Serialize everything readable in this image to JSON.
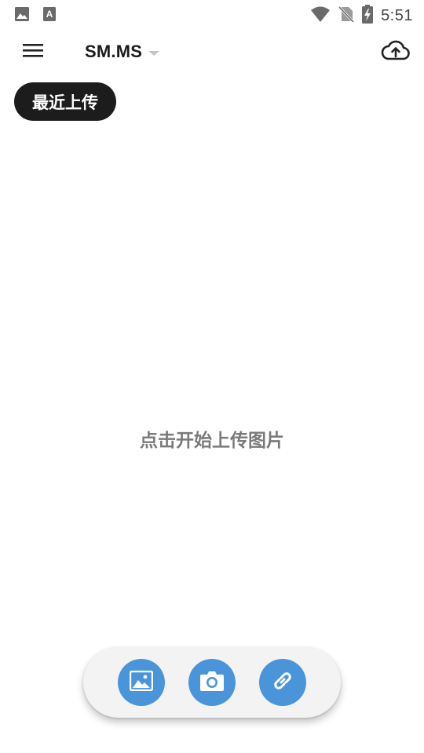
{
  "status_bar": {
    "time": "5:51",
    "icons": [
      "image-icon",
      "text-a-icon",
      "wifi-icon",
      "no-sim-icon",
      "battery-charging-icon"
    ]
  },
  "app_bar": {
    "title": "SM.MS",
    "icons": [
      "menu-icon",
      "dropdown-caret-icon",
      "cloud-upload-icon"
    ]
  },
  "chip": {
    "label": "最近上传"
  },
  "empty_state": {
    "hint": "点击开始上传图片"
  },
  "actions": {
    "icons": [
      "gallery-icon",
      "camera-icon",
      "link-icon"
    ]
  },
  "colors": {
    "accent": "#4a94d9",
    "chip_bg": "#1c1c1c",
    "hint_text": "#7a7a7a",
    "bar_bg": "#f3f3f3"
  }
}
